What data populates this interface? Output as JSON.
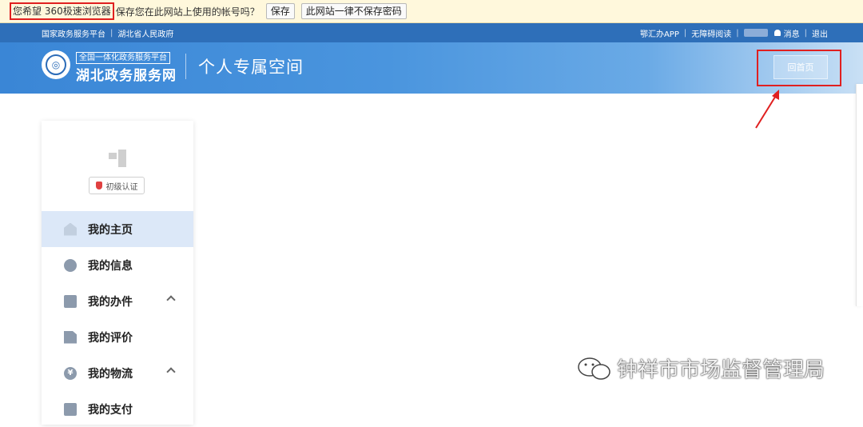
{
  "password_bar": {
    "highlight_text": "您希望 360极速浏览器",
    "rest_text": "保存您在此网站上使用的帐号吗？",
    "save_label": "保存",
    "never_label": "此网站一律不保存密码"
  },
  "top_nav": {
    "links": [
      "国家政务服务平台",
      "湖北省人民政府"
    ],
    "app_label": "鄂汇办APP",
    "accessible_label": "无障碍阅读",
    "message_label": "消息",
    "logout_label": "退出"
  },
  "banner": {
    "brand_subtitle": "全国一体化政务服务平台",
    "brand_title": "湖北政务服务网",
    "page_title": "个人专属空间",
    "home_button": "回首页"
  },
  "sidebar": {
    "certification": "初级认证",
    "items": [
      {
        "label": "我的主页",
        "icon": "home-icon",
        "active": true
      },
      {
        "label": "我的信息",
        "icon": "message-icon"
      },
      {
        "label": "我的办件",
        "icon": "document-icon",
        "expandable": true
      },
      {
        "label": "我的评价",
        "icon": "evaluation-icon"
      },
      {
        "label": "我的物流",
        "icon": "yen-icon",
        "expandable": true
      },
      {
        "label": "我的支付",
        "icon": "payment-icon"
      }
    ]
  },
  "watermark": {
    "text": "钟祥市市场监督管理局"
  },
  "colors": {
    "nav_blue": "#2e6fb9",
    "banner_blue": "#3a86d6",
    "highlight_red": "#e02020",
    "active_item_bg": "#dce8f8"
  }
}
